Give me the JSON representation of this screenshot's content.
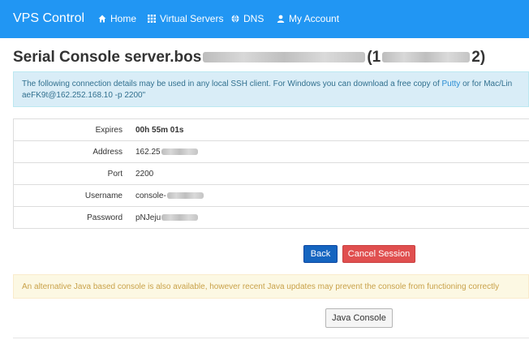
{
  "navbar": {
    "brand": "VPS Control",
    "items": [
      {
        "label": "Home",
        "icon": "home-icon"
      },
      {
        "label": "Virtual Servers",
        "icon": "grid-icon"
      },
      {
        "label": "DNS",
        "icon": "globe-icon"
      },
      {
        "label": "My Account",
        "icon": "user-icon"
      }
    ],
    "color": "#2196f3"
  },
  "page": {
    "title_prefix": "Serial Console server.bos",
    "title_paren_open": "(1",
    "title_paren_close": "2)"
  },
  "info": {
    "line1_before": "The following connection details may be used in any local SSH client. For Windows you can download a free copy of ",
    "putty_link": "Putty",
    "line1_after": " or for Mac/Lin",
    "line2": "aeFK9t@162.252.168.10 -p 2200\""
  },
  "details": [
    {
      "label": "Expires",
      "value": "00h 55m 01s"
    },
    {
      "label": "Address",
      "value": "162.25"
    },
    {
      "label": "Port",
      "value": "2200"
    },
    {
      "label": "Username",
      "value": "console-"
    },
    {
      "label": "Password",
      "value": "pNJeju"
    }
  ],
  "buttons": {
    "back": "Back",
    "cancel": "Cancel Session",
    "java": "Java Console"
  },
  "warning": "An alternative Java based console is also available, however recent Java updates may prevent the console from functioning correctly"
}
